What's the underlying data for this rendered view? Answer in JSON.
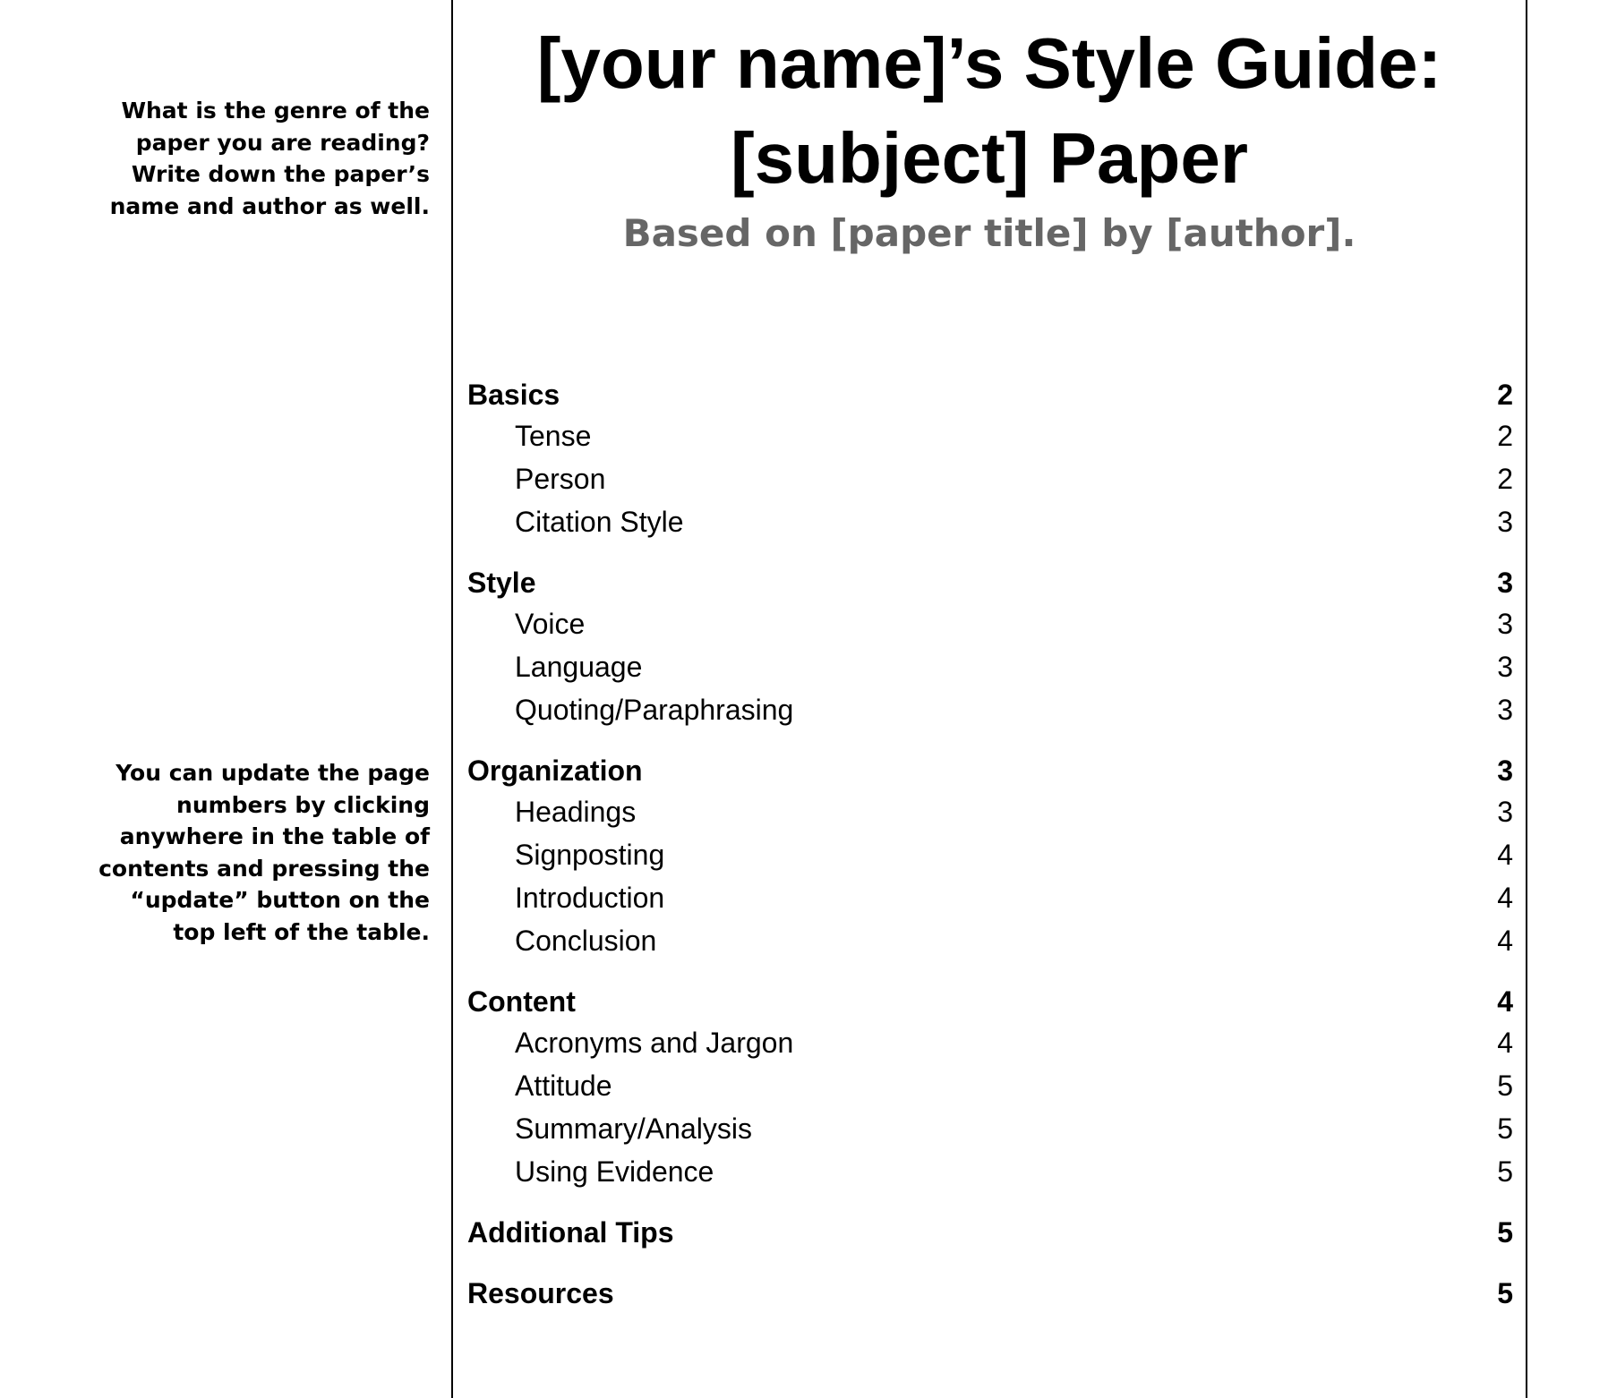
{
  "notes": {
    "genre": [
      "What is the genre of the",
      "paper you are reading?",
      "Write down the paper’s",
      "name and author as well."
    ],
    "update": [
      "You can update the page",
      "numbers by clicking",
      "anywhere in the table of",
      "contents and pressing the",
      "“update” button on the",
      "top left of the table."
    ]
  },
  "document": {
    "title_line1": "[your name]’s Style Guide:",
    "title_line2": "[subject] Paper",
    "subtitle": "Based on [paper title] by [author]."
  },
  "toc": {
    "basics": {
      "label": "Basics",
      "page": "2",
      "items": [
        {
          "label": "Tense",
          "page": "2"
        },
        {
          "label": "Person",
          "page": "2"
        },
        {
          "label": "Citation Style",
          "page": "3"
        }
      ]
    },
    "style": {
      "label": "Style",
      "page": "3",
      "items": [
        {
          "label": "Voice",
          "page": "3"
        },
        {
          "label": "Language",
          "page": "3"
        },
        {
          "label": "Quoting/Paraphrasing",
          "page": "3"
        }
      ]
    },
    "organization": {
      "label": "Organization",
      "page": "3",
      "items": [
        {
          "label": "Headings",
          "page": "3"
        },
        {
          "label": "Signposting",
          "page": "4"
        },
        {
          "label": "Introduction",
          "page": "4"
        },
        {
          "label": "Conclusion",
          "page": "4"
        }
      ]
    },
    "content": {
      "label": "Content",
      "page": "4",
      "items": [
        {
          "label": "Acronyms and Jargon",
          "page": "4"
        },
        {
          "label": "Attitude",
          "page": "5"
        },
        {
          "label": "Summary/Analysis",
          "page": "5"
        },
        {
          "label": "Using Evidence",
          "page": "5"
        }
      ]
    },
    "additional_tips": {
      "label": "Additional Tips",
      "page": "5"
    },
    "resources": {
      "label": "Resources",
      "page": "5"
    }
  }
}
